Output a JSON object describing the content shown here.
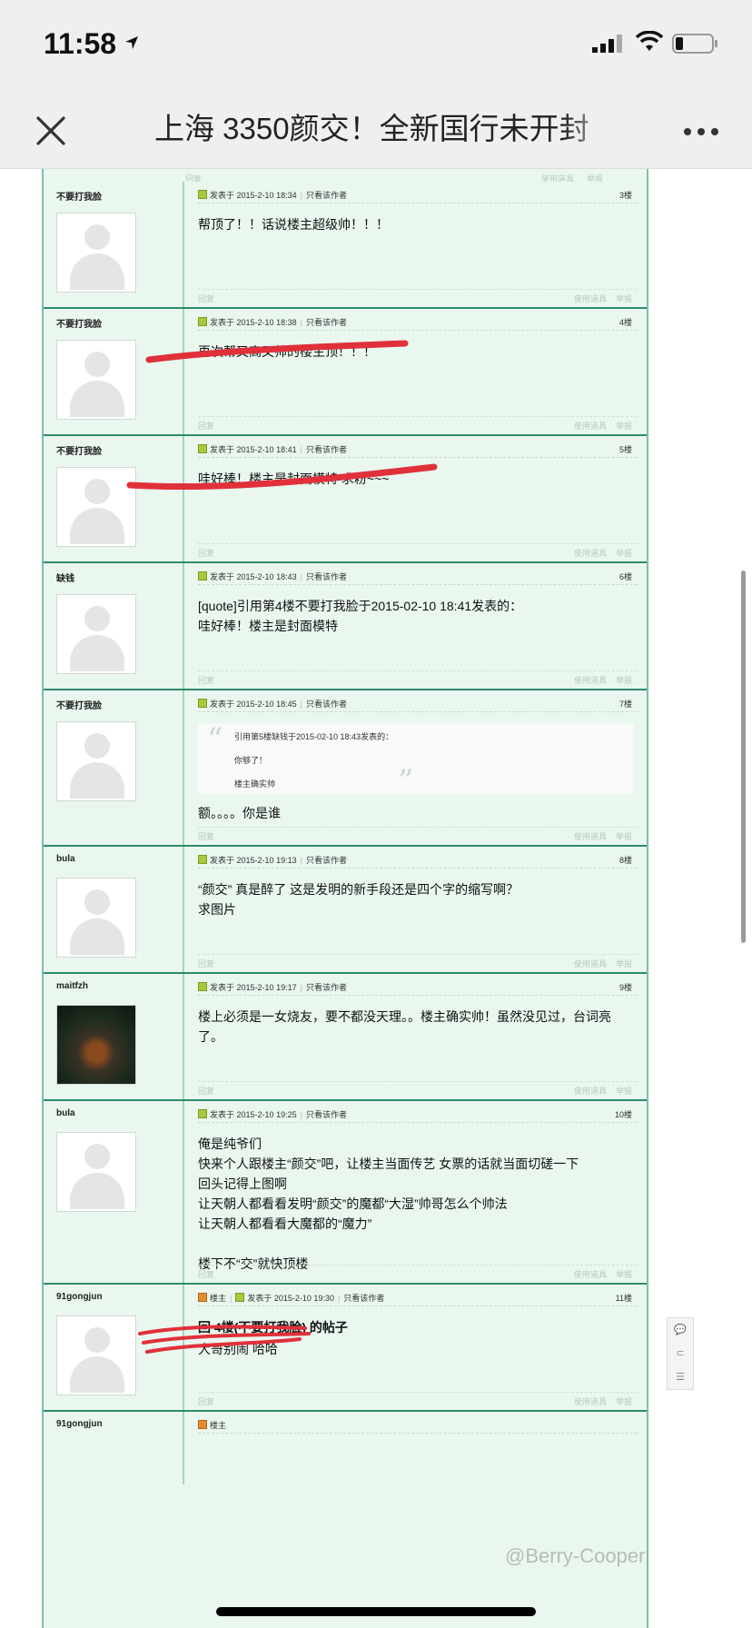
{
  "status_bar": {
    "time": "11:58"
  },
  "nav": {
    "title": "上海 3350颜交！全新国行未开封"
  },
  "footer": {
    "reply": "回复",
    "tools": "使用道具",
    "report": "举报"
  },
  "labels": {
    "posted_at": "发表于",
    "only_author": "只看该作者",
    "op_badge": "楼主"
  },
  "posts": [
    {
      "user": "不要打我脸",
      "date": "2015-2-10 18:34",
      "floor": "3楼",
      "text": "帮顶了！！话说楼主超级帅！！！"
    },
    {
      "user": "不要打我脸",
      "date": "2015-2-10 18:38",
      "floor": "4楼",
      "text": "再次帮又高又帅的楼主顶！！！"
    },
    {
      "user": "不要打我脸",
      "date": "2015-2-10 18:41",
      "floor": "5楼",
      "text": "哇好棒！楼主是封面模特 求粉~~~"
    },
    {
      "user": "缺钱",
      "date": "2015-2-10 18:43",
      "floor": "6楼",
      "text": "[quote]引用第4楼不要打我脸于2015-02-10 18:41发表的：\n哇好棒！楼主是封面模特"
    },
    {
      "user": "不要打我脸",
      "date": "2015-2-10 18:45",
      "floor": "7楼",
      "text": "额。。。。你是谁",
      "quote": {
        "line1": "引用第5楼缺钱于2015-02-10 18:43发表的：",
        "line2": "你够了！",
        "line3": "楼主确实帅"
      }
    },
    {
      "user": "bula",
      "date": "2015-2-10 19:13",
      "floor": "8楼",
      "text": "“颜交” 真是醉了 这是发明的新手段还是四个字的缩写啊？\n求图片"
    },
    {
      "user": "maitfzh",
      "date": "2015-2-10 19:17",
      "floor": "9楼",
      "text": "楼上必须是一女烧友，要不都没天理。。楼主确实帅！虽然没见过，台词亮了。"
    },
    {
      "user": "bula",
      "date": "2015-2-10 19:25",
      "floor": "10楼",
      "text": "俺是纯爷们\n快来个人跟楼主“颜交”吧，让楼主当面传艺 女票的话就当面切磋一下\n回头记得上图啊\n让天朝人都看看发明“颜交”的魔都“大湿”帅哥怎么个帅法\n让天朝人都看看大魔都的“魔力”\n\n楼下不“交”就快顶楼"
    },
    {
      "user": "91gongjun",
      "date": "2015-2-10 19:30",
      "floor": "11楼",
      "title": "回 4楼(不要打我脸) 的帖子",
      "text": "大哥别闹 哈哈"
    },
    {
      "user": "91gongjun"
    }
  ],
  "side_tools": [
    "💬",
    "⊂",
    "☰"
  ],
  "watermark": "@Berry-Cooper"
}
